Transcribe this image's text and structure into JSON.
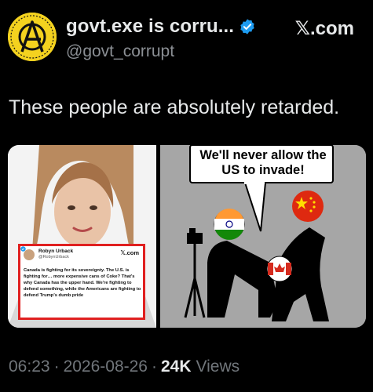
{
  "author": {
    "display_name": "govt.exe is corru...",
    "handle": "@govt_corrupt",
    "verified": true,
    "avatar_icon": "anarchy-symbol-icon",
    "avatar_color": "#f4d21f"
  },
  "brand": "𝕏.com",
  "tweet": {
    "text": "These people are absolutely retarded."
  },
  "media": {
    "left_image": {
      "description_icon": "woman-photo",
      "quoted_card": {
        "name": "Robyn Urback",
        "handle": "@RobynUrback",
        "brand": "𝕏.com",
        "text": "Canada is fighting for its sovereignty. The U.S. is fighting for… more expensive cans of Coke? That's why Canada has the upper hand. We're fighting to defend something, while the Americans are fighting to defend Trump's dumb pride",
        "border_color": "#e02020"
      }
    },
    "right_image": {
      "speech_bubble": "We'll never allow the US to invade!",
      "flags": [
        "india-flag-icon",
        "china-flag-icon",
        "canada-flag-icon"
      ]
    }
  },
  "footer": {
    "time": "06:23",
    "date": "2026-08-26",
    "views_count": "24K",
    "views_label": "Views",
    "separator": "·"
  },
  "colors": {
    "background": "#000000",
    "text": "#e7e9ea",
    "muted": "#71767b",
    "verified": "#1d9bf0"
  }
}
